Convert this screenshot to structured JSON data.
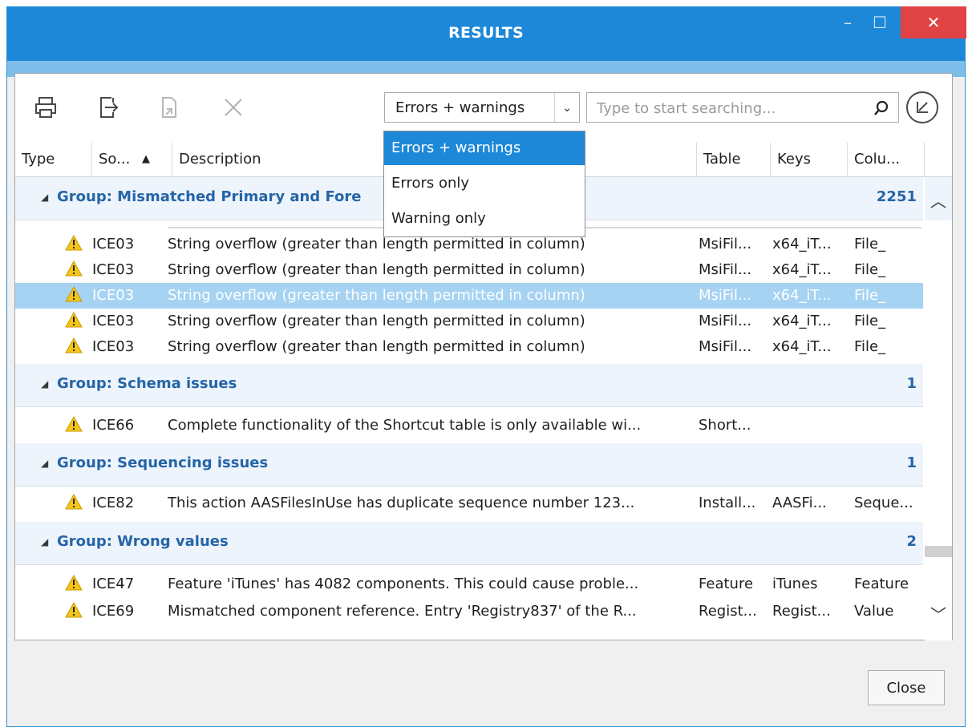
{
  "window": {
    "title": "RESULTS",
    "minimize_glyph": "–",
    "maximize_glyph": "☐",
    "close_glyph": "✕"
  },
  "toolbar": {
    "icons": [
      "printer-icon",
      "export-icon",
      "go-to-icon",
      "delete-icon"
    ],
    "filter_value": "Errors + warnings",
    "filter_arrow": "⌄",
    "search_placeholder": "Type to start searching...",
    "search_icon": "search-icon",
    "nav_icon": "navigate-icon"
  },
  "dropdown": {
    "options": [
      "Errors + warnings",
      "Errors only",
      "Warning only"
    ],
    "selected_index": 0
  },
  "columns": {
    "type": "Type",
    "source": "So...",
    "sort_glyph": "▲",
    "description": "Description",
    "table": "Table",
    "keys": "Keys",
    "column": "Colu..."
  },
  "groups": [
    {
      "title": "Group: Mismatched Primary and Fore",
      "count": "2251",
      "rows": [
        {
          "source": "ICE03",
          "description": "String overflow (greater than length permitted in column)",
          "table": "MsiFil...",
          "keys": "x64_iT...",
          "column": "File_"
        },
        {
          "source": "ICE03",
          "description": "String overflow (greater than length permitted in column)",
          "table": "MsiFil...",
          "keys": "x64_iT...",
          "column": "File_"
        },
        {
          "source": "ICE03",
          "description": "String overflow (greater than length permitted in column)",
          "table": "MsiFil...",
          "keys": "x64_iT...",
          "column": "File_"
        },
        {
          "source": "ICE03",
          "description": "String overflow (greater than length permitted in column)",
          "table": "MsiFil...",
          "keys": "x64_iT...",
          "column": "File_"
        },
        {
          "source": "ICE03",
          "description": "String overflow (greater than length permitted in column)",
          "table": "MsiFil...",
          "keys": "x64_iT...",
          "column": "File_"
        }
      ]
    },
    {
      "title": "Group: Schema issues",
      "count": "1",
      "rows": [
        {
          "source": "ICE66",
          "description": "Complete functionality of the Shortcut table is only available wi...",
          "table": "Short...",
          "keys": "",
          "column": ""
        }
      ]
    },
    {
      "title": "Group: Sequencing issues",
      "count": "1",
      "rows": [
        {
          "source": "ICE82",
          "description": "This action AASFilesInUse has duplicate sequence number 123...",
          "table": "Install...",
          "keys": "AASFi...",
          "column": "Seque..."
        }
      ]
    },
    {
      "title": "Group: Wrong values",
      "count": "2",
      "rows": [
        {
          "source": "ICE47",
          "description": "Feature 'iTunes' has 4082 components. This could cause proble...",
          "table": "Feature",
          "keys": "iTunes",
          "column": "Feature"
        },
        {
          "source": "ICE69",
          "description": "Mismatched component reference. Entry 'Registry837' of the R...",
          "table": "Regist...",
          "keys": "Regist...",
          "column": "Value"
        }
      ]
    }
  ],
  "footer": {
    "close_label": "Close"
  },
  "colors": {
    "title_bar": "#1e88d8",
    "close_red": "#e04343",
    "group_text": "#2565a8",
    "selected_row": "#a6d3f2",
    "warning_yellow": "#f5c518"
  }
}
